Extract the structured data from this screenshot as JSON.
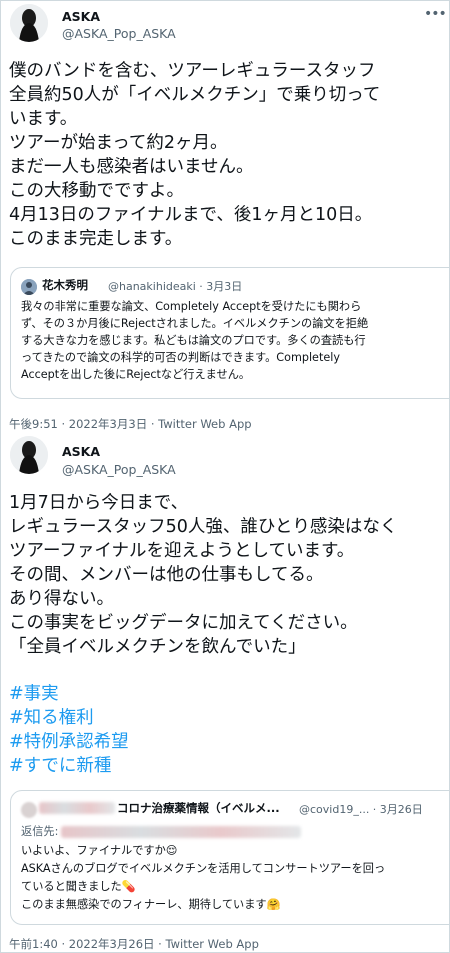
{
  "tweet1": {
    "name": "ASKA",
    "handle": "@ASKA_Pop_ASKA",
    "more_icon": "ellipsis-icon",
    "lines": [
      "僕のバンドを含む、ツアーレギュラースタッフ",
      "全員約50人が「イベルメクチン」で乗り切って",
      "います。",
      "ツアーが始まって約2ヶ月。",
      "まだ一人も感染者はいません。",
      "この大移動でですよ。",
      "4月13日のファイナルまで、後1ヶ月と10日。",
      "このまま完走します。"
    ],
    "quote": {
      "name": "花木秀明",
      "handle": "@hanakihideaki · 3月3日",
      "lines": [
        "我々の非常に重要な論文、Completely Acceptを受けたにも関わら",
        "ず、その３か月後にRejectされました。イベルメクチンの論文を拒絶",
        "する大きな力を感じます。私どもは論文のプロです。多くの査読も行",
        "ってきたので論文の科学的可否の判断はできます。Completely",
        "Acceptを出した後にRejectなど行えません。"
      ]
    },
    "timestamp": "午後9:51 · 2022年3月3日 · Twitter Web App"
  },
  "tweet2": {
    "name": "ASKA",
    "handle": "@ASKA_Pop_ASKA",
    "lines": [
      "1月7日から今日まで、",
      "レギュラースタッフ50人強、誰ひとり感染はなく",
      "ツアーファイナルを迎えようとしています。",
      "その間、メンバーは他の仕事もしてる。",
      "あり得ない。",
      "この事実をビッグデータに加えてください。",
      "「全員イベルメクチンを飲んでいた」"
    ],
    "hashtags": [
      "#事実",
      "#知る権利",
      "#特例承認希望",
      "#すでに新種"
    ],
    "quote": {
      "name": "コロナ治療薬情報（イベルメ...",
      "handle": "@covid19_... · 3月26日",
      "reply_label": "返信先:",
      "lines": [
        "いよいよ、ファイナルですか😌",
        "ASKAさんのブログでイベルメクチンを活用してコンサートツアーを回っ",
        "ていると聞きました💊",
        "このまま無感染でのフィナーレ、期待しています🤗"
      ]
    },
    "timestamp": "午前1:40 · 2022年3月26日 · Twitter Web App"
  }
}
